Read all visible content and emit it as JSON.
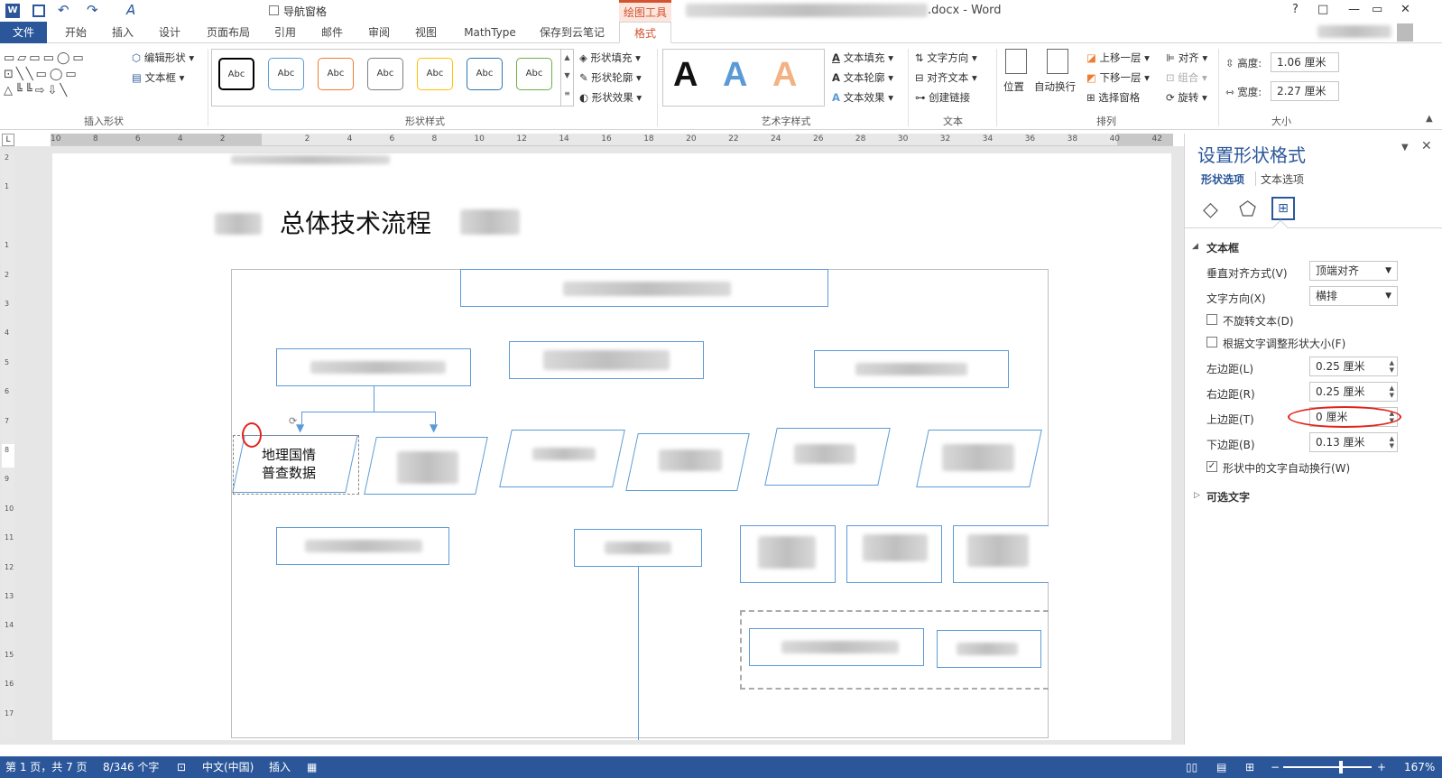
{
  "titlebar": {
    "title": ".docx - Word",
    "drawing_tools": "绘图工具",
    "nav_pane": "导航窗格",
    "help": "?",
    "restore": "□",
    "minimize": "—",
    "maximize": "▭",
    "close": "✕"
  },
  "tabs": [
    "文件",
    "开始",
    "插入",
    "设计",
    "页面布局",
    "引用",
    "邮件",
    "审阅",
    "视图",
    "MathType",
    "保存到云笔记",
    "格式"
  ],
  "ribbon": {
    "insert_shapes": {
      "label": "插入形状",
      "edit_shape": "编辑形状",
      "text_box": "文本框"
    },
    "shape_styles": {
      "label": "形状样式",
      "abc": "Abc",
      "fill": "形状填充",
      "outline": "形状轮廓",
      "effect": "形状效果"
    },
    "wordart": {
      "label": "艺术字样式",
      "glyph": "A",
      "text_fill": "文本填充",
      "text_outline": "文本轮廓",
      "text_effect": "文本效果"
    },
    "text": {
      "label": "文本",
      "direction": "文字方向",
      "align": "对齐文本",
      "link": "创建链接"
    },
    "arrange": {
      "label": "排列",
      "position": "位置",
      "wrap": "自动换行",
      "forward": "上移一层",
      "backward": "下移一层",
      "selection": "选择窗格",
      "align": "对齐",
      "group": "组合",
      "rotate": "旋转"
    },
    "size": {
      "label": "大小",
      "height_label": "高度:",
      "height": "1.06 厘米",
      "width_label": "宽度:",
      "width": "2.27 厘米"
    }
  },
  "ruler": {
    "h_ticks": [
      "10",
      "8",
      "6",
      "4",
      "2",
      "",
      "2",
      "4",
      "6",
      "8",
      "10",
      "12",
      "14",
      "16",
      "18",
      "20",
      "22",
      "24",
      "26",
      "28",
      "30",
      "32",
      "34",
      "36",
      "38",
      "40",
      "42"
    ],
    "v_ticks": [
      "2",
      "1",
      "",
      "1",
      "2",
      "3",
      "4",
      "5",
      "6",
      "7",
      "8",
      "9",
      "10",
      "11",
      "12",
      "13",
      "14",
      "15",
      "16",
      "17"
    ]
  },
  "document": {
    "heading": "总体技术流程",
    "selected_box": "地理国情\n普查数据"
  },
  "pane": {
    "title": "设置形状格式",
    "tab_shape": "形状选项",
    "tab_text": "文本选项",
    "section": "文本框",
    "valign_label": "垂直对齐方式(V)",
    "valign_value": "顶端对齐",
    "dir_label": "文字方向(X)",
    "dir_value": "横排",
    "no_rotate": "不旋转文本(D)",
    "resize": "根据文字调整形状大小(F)",
    "left_label": "左边距(L)",
    "left_value": "0.25 厘米",
    "right_label": "右边距(R)",
    "right_value": "0.25 厘米",
    "top_label": "上边距(T)",
    "top_value": "0 厘米",
    "bottom_label": "下边距(B)",
    "bottom_value": "0.13 厘米",
    "wrap": "形状中的文字自动换行(W)",
    "alt_text": "可选文字"
  },
  "status": {
    "page": "第 1 页，共 7 页",
    "words": "8/346 个字",
    "lang": "中文(中国)",
    "mode": "插入",
    "zoom": "167%"
  },
  "colors": {
    "accent": "#2b579a",
    "format_tab": "#d35230",
    "shape_border": "#5b9bd5",
    "annotation": "#e3231b"
  }
}
